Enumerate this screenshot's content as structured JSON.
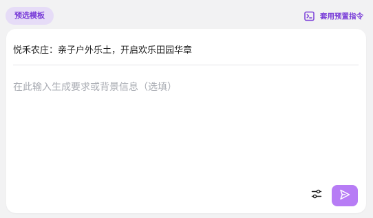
{
  "header": {
    "template_button_label": "预选模板",
    "preset_command_label": "套用预置指令",
    "preset_command_icon": "terminal-icon"
  },
  "editor": {
    "title_value": "悦禾农庄：亲子户外乐土，开启欢乐田园华章",
    "info_placeholder": "在此输入生成要求或背景信息（选填）"
  },
  "toolbar": {
    "settings_icon": "sliders-icon",
    "send_icon": "send-icon"
  },
  "colors": {
    "accent": "#7a3ed8",
    "chip_bg": "#e6dcf7",
    "send_bg": "#b77cf5",
    "page_bg": "#f2f2f3"
  }
}
